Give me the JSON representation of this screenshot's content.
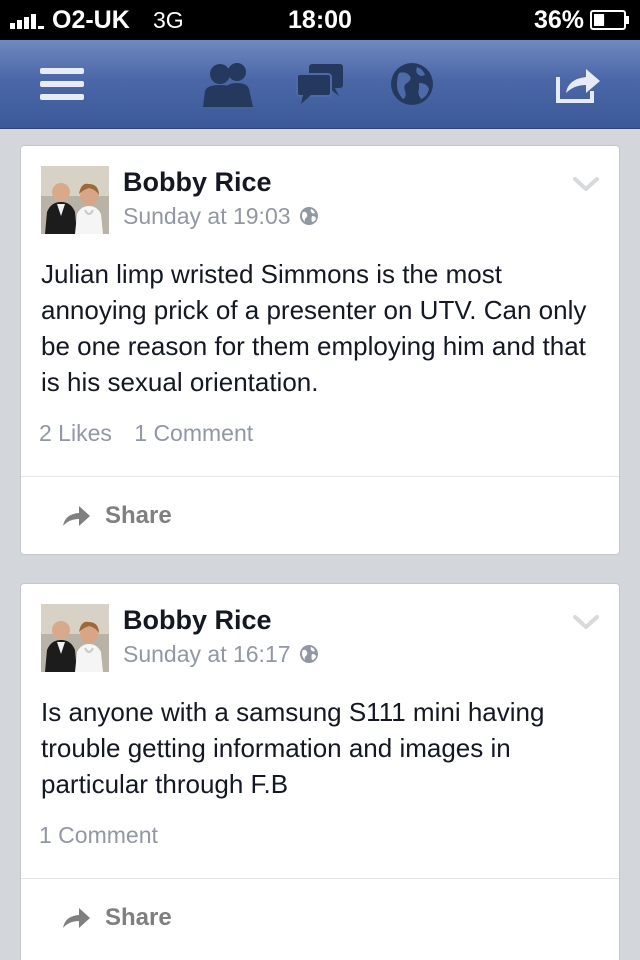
{
  "status_bar": {
    "carrier": "O2-UK",
    "network": "3G",
    "time": "18:00",
    "battery_percent": "36%",
    "battery_level": 0.36
  },
  "nav_bar": {
    "icons": [
      "menu-icon",
      "friend-requests-icon",
      "messages-icon",
      "notifications-globe-icon",
      "share-status-icon"
    ],
    "color": "#3b5998"
  },
  "posts": [
    {
      "author": "Bobby Rice",
      "timestamp": "Sunday at 19:03",
      "privacy": "globe-icon",
      "message": "Julian limp wristed Simmons is the most annoying prick of a presenter on UTV. Can only be one reason for them employing him and that is his sexual orientation.",
      "likes": "2 Likes",
      "comments": "1 Comment",
      "share_label": "Share"
    },
    {
      "author": "Bobby Rice",
      "timestamp": "Sunday at 16:17",
      "privacy": "globe-icon",
      "message": "Is anyone with a samsung S111 mini having trouble getting information and images in particular through F.B",
      "likes": "",
      "comments": "1 Comment",
      "share_label": "Share"
    }
  ]
}
